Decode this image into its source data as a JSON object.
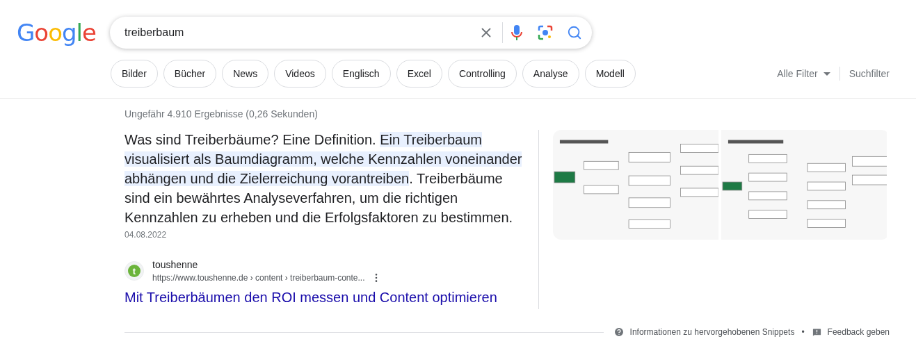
{
  "logo": "Google",
  "search": {
    "value": "treiberbaum"
  },
  "chips": [
    {
      "label": "Bilder"
    },
    {
      "label": "Bücher"
    },
    {
      "label": "News"
    },
    {
      "label": "Videos"
    },
    {
      "label": "Englisch"
    },
    {
      "label": "Excel"
    },
    {
      "label": "Controlling"
    },
    {
      "label": "Analyse"
    },
    {
      "label": "Modell"
    }
  ],
  "filters": {
    "all_filters": "Alle Filter",
    "search_filters": "Suchfilter"
  },
  "result_stats": "Ungefähr 4.910 Ergebnisse (0,26 Sekunden)",
  "snippet": {
    "parts": [
      {
        "text": "Was sind Treiberbäume? Eine Definition. ",
        "highlighted": false
      },
      {
        "text": "Ein Treiberbaum visualisiert als Baumdiagramm, welche Kennzahlen voneinander abhängen und die Zielerreichung vorantreiben",
        "highlighted": true
      },
      {
        "text": ". Treiberbäume sind ein bewährtes Analyseverfahren, um die richtigen Kennzahlen zu erheben und die Erfolgsfaktoren zu bestimmen.",
        "highlighted": false
      }
    ],
    "date": "04.08.2022",
    "site_name": "toushenne",
    "favicon_letter": "t",
    "url": "https://www.toushenne.de › content › treiberbaum-conte...",
    "title": "Mit Treiberbäumen den ROI messen und Content optimieren"
  },
  "footer": {
    "about": "Informationen zu hervorgehobenen Snippets",
    "separator": "•",
    "feedback": "Feedback geben"
  }
}
